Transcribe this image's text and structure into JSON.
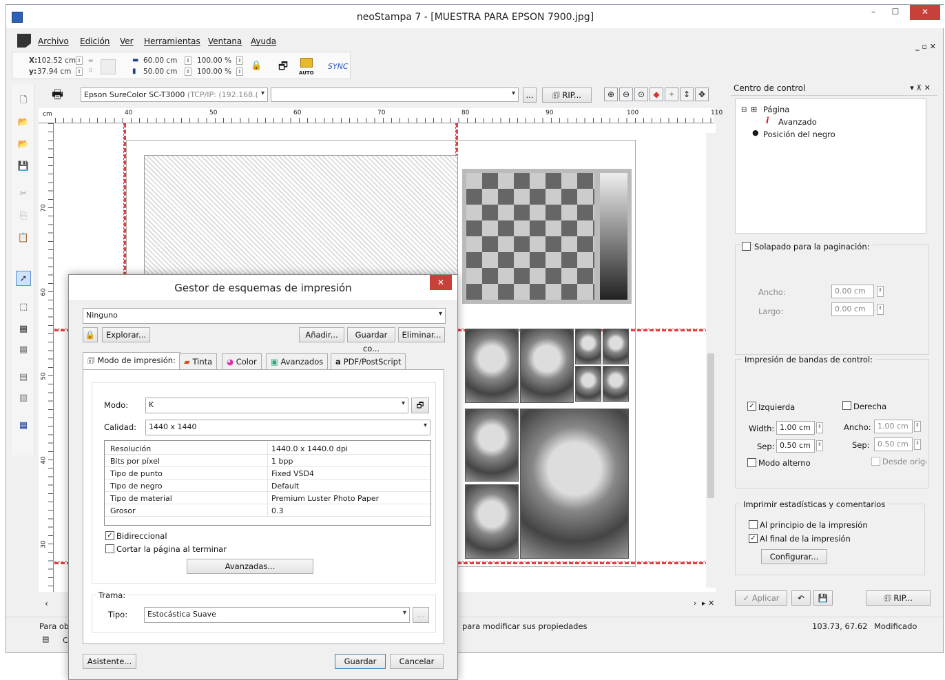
{
  "window": {
    "title": "neoStampa 7 - [MUESTRA PARA EPSON 7900.jpg]",
    "controls": {
      "minimize": "–",
      "maximize": "☐",
      "close": "✕"
    }
  },
  "menu": {
    "items": [
      "Archivo",
      "Edición",
      "Ver",
      "Herramientas",
      "Ventana",
      "Ayuda"
    ],
    "mdi_controls": "_ ▫ ✕"
  },
  "coords": {
    "x_label": "X:",
    "x_value": "102.52 cm",
    "y_label": "y:",
    "y_value": "37.94 cm",
    "width_value": "60.00 cm",
    "height_value": "50.00 cm",
    "width_pct": "100.00 %",
    "height_pct": "100.00 %",
    "auto_label": "AUTO",
    "sync_label": "SYNC"
  },
  "printer_bar": {
    "printer": "Epson SureColor SC-T3000",
    "connection": "(TCP/IP: (192.168.(",
    "second_combo": "",
    "ellipsis": "...",
    "rip_label": "RIP..."
  },
  "ruler": {
    "unit": "cm",
    "h_ticks": [
      "40",
      "50",
      "60",
      "70",
      "80",
      "90",
      "100",
      "110"
    ],
    "v_ticks": [
      "70",
      "60",
      "50",
      "40",
      "30"
    ]
  },
  "canvas": {
    "status_hint": "para modificar sus propiedades",
    "left_hint": "Para ob",
    "left_hint2": "C"
  },
  "statusbar": {
    "coords": "103.73, 67.62",
    "state": "Modificado"
  },
  "control_center": {
    "title": "Centro de control",
    "tree": {
      "page": "Página",
      "advanced": "Avanzado",
      "black_position": "Posición del negro"
    },
    "overlap": {
      "label": "Solapado para la paginación:",
      "checked": false,
      "width_label": "Ancho:",
      "width_value": "0.00 cm",
      "length_label": "Largo:",
      "length_value": "0.00 cm"
    },
    "bands": {
      "label": "Impresión de bandas de control:",
      "left_label": "Izquierda",
      "left_checked": true,
      "right_label": "Derecha",
      "right_checked": false,
      "width_label": "Width:",
      "width_value": "1.00 cm",
      "sep_label": "Sep:",
      "sep_value": "0.50 cm",
      "ancho_label": "Ancho:",
      "ancho_value": "1.00 cm",
      "sep2_label": "Sep:",
      "sep2_value": "0.50 cm",
      "alt_mode": "Modo alterno",
      "alt_checked": false,
      "from_origin": "Desde origen"
    },
    "stats": {
      "label": "Imprimir estadísticas y comentarios",
      "start": "Al principio de la impresión",
      "start_checked": false,
      "end": "Al final de la impresión",
      "end_checked": true,
      "configure": "Configurar..."
    },
    "buttons": {
      "apply": "Aplicar",
      "rip": "RIP..."
    }
  },
  "dialog": {
    "title": "Gestor de esquemas de impresión",
    "scheme": "Ninguno",
    "explore": "Explorar...",
    "add": "Añadir...",
    "save_as": "Guardar co...",
    "delete": "Eliminar...",
    "tabs": [
      "Modo de impresión:",
      "Tinta",
      "Color",
      "Avanzados",
      "PDF/PostScript"
    ],
    "mode_label": "Modo:",
    "mode_value": "K",
    "quality_label": "Calidad:",
    "quality_value": "1440 x 1440",
    "properties": [
      {
        "key": "Resolución",
        "value": "1440.0 x 1440.0 dpi"
      },
      {
        "key": "Bits por píxel",
        "value": "1 bpp"
      },
      {
        "key": "Tipo de punto",
        "value": "Fixed VSD4"
      },
      {
        "key": "Tipo de negro",
        "value": "Default"
      },
      {
        "key": "Tipo de material",
        "value": "Premium Luster Photo Paper"
      },
      {
        "key": "Grosor",
        "value": "0.3"
      }
    ],
    "bidirectional": "Bidireccional",
    "bidirectional_checked": true,
    "cut_page": "Cortar la página al terminar",
    "cut_checked": false,
    "advanced_btn": "Avanzadas...",
    "screen_group": "Trama:",
    "type_label": "Tipo:",
    "type_value": "Estocástica Suave",
    "wizard": "Asistente...",
    "save": "Guardar",
    "cancel": "Cancelar"
  }
}
